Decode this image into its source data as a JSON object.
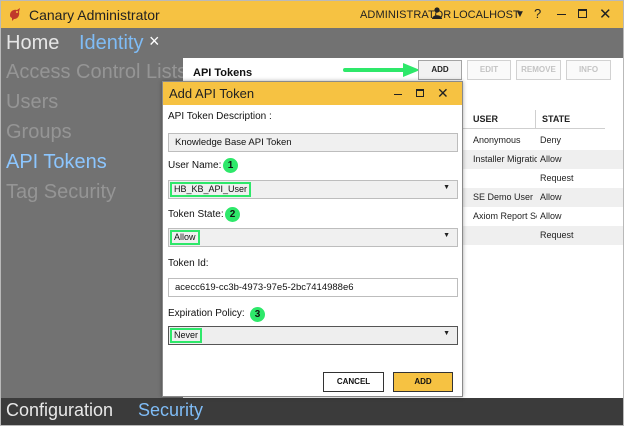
{
  "window": {
    "title": "Canary Administrator",
    "user": "ADMINISTRATOR",
    "host": "LOCALHOST",
    "help": "?",
    "close": "✕"
  },
  "nav": {
    "home": "Home",
    "identity": "Identity",
    "identity_close": "×"
  },
  "sidebar": {
    "items": [
      {
        "label": "Access Control Lists",
        "active": false
      },
      {
        "label": "Users",
        "active": false
      },
      {
        "label": "Groups",
        "active": false
      },
      {
        "label": "API Tokens",
        "active": true
      },
      {
        "label": "Tag Security",
        "active": false
      }
    ]
  },
  "panel": {
    "title": "API Tokens",
    "buttons": {
      "add": "ADD",
      "edit": "EDIT",
      "remove": "REMOVE",
      "info": "INFO"
    },
    "columns": {
      "user": "USER",
      "state": "STATE"
    },
    "rows": [
      {
        "user": "Anonymous",
        "state": "Deny"
      },
      {
        "user": "Installer Migration",
        "state": "Allow"
      },
      {
        "user": "",
        "state": "Request"
      },
      {
        "user": "SE Demo User",
        "state": "Allow"
      },
      {
        "user": "Axiom Report Service",
        "state": "Allow"
      },
      {
        "user": "",
        "state": "Request"
      }
    ]
  },
  "dialog": {
    "title": "Add API Token",
    "description_label": "API Token Description :",
    "description_value": "Knowledge Base API Token",
    "user_name_label": "User Name:",
    "user_name_value": "HB_KB_API_User",
    "token_state_label": "Token State:",
    "token_state_value": "Allow",
    "token_id_label": "Token Id:",
    "token_id_value": "acecc619-cc3b-4973-97e5-2bc7414988e6",
    "expiration_label": "Expiration Policy:",
    "expiration_value": "Never",
    "badges": [
      "1",
      "2",
      "3"
    ],
    "cancel": "CANCEL",
    "add": "ADD"
  },
  "bottombar": {
    "configuration": "Configuration",
    "security": "Security"
  },
  "colors": {
    "accent": "#f6c242",
    "highlight": "#2ee86a",
    "link": "#7fbcf6",
    "app_bg": "#727272"
  }
}
